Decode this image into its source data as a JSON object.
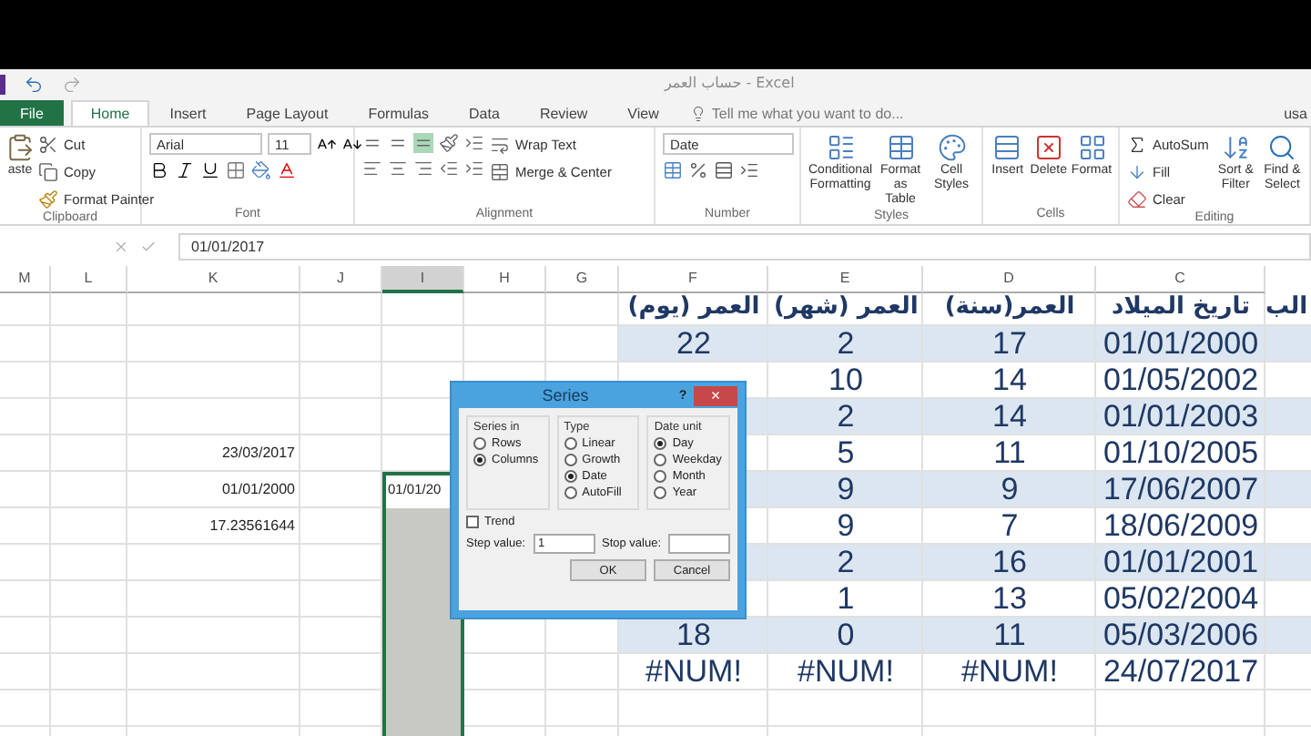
{
  "title": "حساب العمر - Excel",
  "tabs": [
    {
      "label": "File",
      "kind": "file",
      "selected": false
    },
    {
      "label": "Home",
      "kind": "tab",
      "selected": true
    },
    {
      "label": "Insert",
      "kind": "tab",
      "selected": false
    },
    {
      "label": "Page Layout",
      "kind": "tab",
      "selected": false
    },
    {
      "label": "Formulas",
      "kind": "tab",
      "selected": false
    },
    {
      "label": "Data",
      "kind": "tab",
      "selected": false
    },
    {
      "label": "Review",
      "kind": "tab",
      "selected": false
    },
    {
      "label": "View",
      "kind": "tab",
      "selected": false
    }
  ],
  "tell_me": "Tell me what you want to do...",
  "account": "usa",
  "ribbon": {
    "clipboard": {
      "label": "Clipboard",
      "paste": "aste",
      "cut": "Cut",
      "copy": "Copy",
      "format_painter": "Format Painter"
    },
    "font": {
      "label": "Font",
      "font_name": "Arial",
      "font_size": "11"
    },
    "alignment": {
      "label": "Alignment",
      "wrap_text": "Wrap Text",
      "merge": "Merge & Center"
    },
    "number": {
      "label": "Number",
      "format": "Date"
    },
    "styles": {
      "label": "Styles",
      "buttons": [
        "Conditional Formatting",
        "Format as Table",
        "Cell Styles"
      ]
    },
    "cells": {
      "label": "Cells",
      "buttons": [
        "Insert",
        "Delete",
        "Format"
      ]
    },
    "editing": {
      "label": "Editing",
      "autosum": "AutoSum",
      "fill": "Fill",
      "clear": "Clear",
      "sort": "Sort & Filter",
      "find": "Find & Select"
    }
  },
  "formula_bar": {
    "value": "01/01/2017"
  },
  "columns": [
    {
      "letter": "M",
      "selected": false
    },
    {
      "letter": "L",
      "selected": false
    },
    {
      "letter": "K",
      "selected": false
    },
    {
      "letter": "J",
      "selected": false
    },
    {
      "letter": "I",
      "selected": true
    },
    {
      "letter": "H",
      "selected": false
    },
    {
      "letter": "G",
      "selected": false
    },
    {
      "letter": "F",
      "selected": false
    },
    {
      "letter": "E",
      "selected": false
    },
    {
      "letter": "D",
      "selected": false
    },
    {
      "letter": "C",
      "selected": false
    }
  ],
  "rows": [
    {
      "kind": "header",
      "band": false,
      "selected": false,
      "active": false,
      "cells": {
        "F": "العمر (يوم)",
        "E": "العمر (شهر)",
        "D": "العمر(سنة)",
        "C": "تاريخ الميلاد"
      },
      "cut": "الب"
    },
    {
      "kind": "data",
      "band": true,
      "selected": false,
      "active": false,
      "cells": {
        "F": "22",
        "E": "2",
        "D": "17",
        "C": "01/01/2000"
      }
    },
    {
      "kind": "data",
      "band": false,
      "selected": false,
      "active": false,
      "cells": {
        "E": "10",
        "D": "14",
        "C": "01/05/2002"
      }
    },
    {
      "kind": "data",
      "band": true,
      "selected": false,
      "active": false,
      "cells": {
        "E": "2",
        "D": "14",
        "C": "01/01/2003"
      }
    },
    {
      "kind": "data",
      "band": false,
      "selected": false,
      "active": false,
      "cells": {
        "K": "23/03/2017",
        "E": "5",
        "D": "11",
        "C": "01/10/2005"
      }
    },
    {
      "kind": "data",
      "band": true,
      "selected": true,
      "active": true,
      "cells": {
        "K": "01/01/2000",
        "I": "01/01/20",
        "E": "9",
        "D": "9",
        "C": "17/06/2007"
      }
    },
    {
      "kind": "data",
      "band": false,
      "selected": true,
      "active": false,
      "cells": {
        "K": "17.23561644",
        "E": "9",
        "D": "7",
        "C": "18/06/2009"
      }
    },
    {
      "kind": "data",
      "band": true,
      "selected": true,
      "active": false,
      "cells": {
        "E": "2",
        "D": "16",
        "C": "01/01/2001"
      }
    },
    {
      "kind": "data",
      "band": false,
      "selected": true,
      "active": false,
      "cells": {
        "E": "1",
        "D": "13",
        "C": "05/02/2004"
      }
    },
    {
      "kind": "data",
      "band": true,
      "selected": true,
      "active": false,
      "cells": {
        "F": "18",
        "E": "0",
        "D": "11",
        "C": "05/03/2006"
      }
    },
    {
      "kind": "data",
      "band": false,
      "selected": true,
      "active": false,
      "cells": {
        "F": "#NUM!",
        "E": "#NUM!",
        "D": "#NUM!",
        "C": "24/07/2017"
      }
    }
  ],
  "dialog": {
    "title": "Series",
    "help": "?",
    "close": "×",
    "groups": [
      {
        "label": "Series in",
        "options": [
          {
            "label": "Rows",
            "selected": false
          },
          {
            "label": "Columns",
            "selected": true
          }
        ]
      },
      {
        "label": "Type",
        "options": [
          {
            "label": "Linear",
            "selected": false
          },
          {
            "label": "Growth",
            "selected": false
          },
          {
            "label": "Date",
            "selected": true
          },
          {
            "label": "AutoFill",
            "selected": false
          }
        ]
      },
      {
        "label": "Date unit",
        "options": [
          {
            "label": "Day",
            "selected": true
          },
          {
            "label": "Weekday",
            "selected": false
          },
          {
            "label": "Month",
            "selected": false
          },
          {
            "label": "Year",
            "selected": false
          }
        ]
      }
    ],
    "trend": {
      "label": "Trend",
      "checked": false
    },
    "step": {
      "label": "Step value:",
      "value": "1"
    },
    "stop": {
      "label": "Stop value:"
    },
    "buttons": [
      "OK",
      "Cancel"
    ]
  }
}
